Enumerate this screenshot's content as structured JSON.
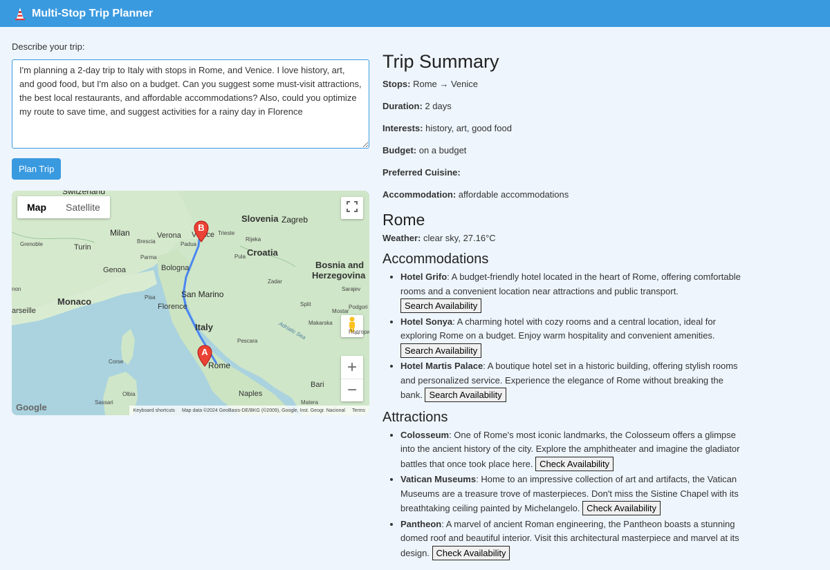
{
  "header": {
    "title": "Multi-Stop Trip Planner",
    "icon": "traffic-cone-icon"
  },
  "form": {
    "label": "Describe your trip:",
    "trip_text": "I'm planning a 2-day trip to Italy with stops in Rome, and Venice. I love history, art, and good food, but I'm also on a budget. Can you suggest some must-visit attractions, the best local restaurants, and affordable accommodations? Also, could you optimize my route to save time, and suggest activities for a rainy day in Florence",
    "plan_button": "Plan Trip"
  },
  "map": {
    "type_map": "Map",
    "type_satellite": "Satellite",
    "marker_a": "A",
    "marker_b": "B",
    "labels": {
      "switzerland": "Switzerland",
      "slovenia": "Slovenia",
      "zagreb": "Zagreb",
      "milan": "Milan",
      "verona": "Verona",
      "venice": "Venice",
      "trieste": "Trieste",
      "rijeka": "Rijeka",
      "grenoble": "Grenoble",
      "turin": "Turin",
      "brescia": "Brescia",
      "padua": "Padua",
      "parma": "Parma",
      "pula": "Pula",
      "croatia": "Croatia",
      "bosnia": "Bosnia and",
      "herzegovina": "Herzegovina",
      "genoa": "Genoa",
      "bologna": "Bologna",
      "zadar": "Zadar",
      "sarajevo": "Sarajev",
      "monaco": "Monaco",
      "pisa": "Pisa",
      "san_marino": "San Marino",
      "florence": "Florence",
      "split": "Split",
      "marseille": "arseille",
      "italy": "Italy",
      "mostar": "Mostar",
      "makarska": "Makarska",
      "podgori": "Podgori",
      "podgori_cyr": "Подгори",
      "adriatic": "Adriatic Sea",
      "pescara": "Pescara",
      "corse": "Corse",
      "rome": "Rome",
      "olbia": "Olbia",
      "naples": "Naples",
      "bari": "Bari",
      "sassari": "Sassari",
      "matera": "Matera",
      "toulon": "non"
    },
    "footer_shortcuts": "Keyboard shortcuts",
    "footer_data": "Map data ©2024 GeoBasis-DE/BKG (©2009), Google, Inst. Geogr. Nacional",
    "footer_terms": "Terms",
    "google": "Google"
  },
  "summary": {
    "title": "Trip Summary",
    "stops_label": "Stops:",
    "stops_value": "Rome → Venice",
    "duration_label": "Duration:",
    "duration_value": "2 days",
    "interests_label": "Interests:",
    "interests_value": "history, art, good food",
    "budget_label": "Budget:",
    "budget_value": "on a budget",
    "cuisine_label": "Preferred Cuisine:",
    "cuisine_value": "",
    "accommodation_label": "Accommodation:",
    "accommodation_value": "affordable accommodations"
  },
  "city": {
    "name": "Rome",
    "weather_label": "Weather:",
    "weather_value": "clear sky, 27.16°C",
    "accommodations_title": "Accommodations",
    "hotels": [
      {
        "name": "Hotel Grifo",
        "desc": ": A budget-friendly hotel located in the heart of Rome, offering comfortable rooms and a convenient location near attractions and public transport.",
        "button": "Search Availability"
      },
      {
        "name": "Hotel Sonya",
        "desc": ": A charming hotel with cozy rooms and a central location, ideal for exploring Rome on a budget. Enjoy warm hospitality and convenient amenities.",
        "button": "Search Availability"
      },
      {
        "name": "Hotel Martis Palace",
        "desc": ": A boutique hotel set in a historic building, offering stylish rooms and personalized service. Experience the elegance of Rome without breaking the bank.",
        "button": "Search Availability"
      }
    ],
    "attractions_title": "Attractions",
    "attractions": [
      {
        "name": "Colosseum",
        "desc": ": One of Rome's most iconic landmarks, the Colosseum offers a glimpse into the ancient history of the city. Explore the amphitheater and imagine the gladiator battles that once took place here.",
        "button": "Check Availability"
      },
      {
        "name": "Vatican Museums",
        "desc": ": Home to an impressive collection of art and artifacts, the Vatican Museums are a treasure trove of masterpieces. Don't miss the Sistine Chapel with its breathtaking ceiling painted by Michelangelo.",
        "button": "Check Availability"
      },
      {
        "name": "Pantheon",
        "desc": ": A marvel of ancient Roman engineering, the Pantheon boasts a stunning domed roof and beautiful interior. Visit this architectural masterpiece and marvel at its design.",
        "button": "Check Availability"
      }
    ]
  }
}
